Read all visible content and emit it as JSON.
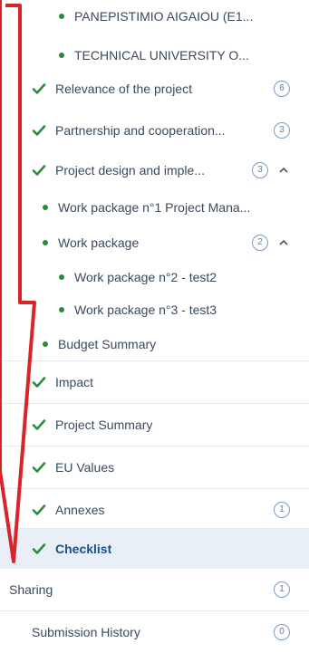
{
  "nav": {
    "items": [
      {
        "label": "PANEPISTIMIO AIGAIOU (E1...",
        "marker": "dot"
      },
      {
        "label": "TECHNICAL UNIVERSITY O...",
        "marker": "dot"
      },
      {
        "label": "Relevance of the project",
        "marker": "check",
        "count": "6"
      },
      {
        "label": "Partnership and cooperation...",
        "marker": "check",
        "count": "3"
      },
      {
        "label": "Project design and imple...",
        "marker": "check",
        "count": "3",
        "expanded": true
      },
      {
        "label": "Work package n°1 Project Mana...",
        "marker": "dot"
      },
      {
        "label": "Work package",
        "marker": "dot",
        "count": "2",
        "expanded": true
      },
      {
        "label": "Work package n°2 - test2",
        "marker": "dot"
      },
      {
        "label": "Work package n°3 - test3",
        "marker": "dot"
      },
      {
        "label": "Budget Summary",
        "marker": "dot"
      },
      {
        "label": "Impact",
        "marker": "check"
      },
      {
        "label": "Project Summary",
        "marker": "check"
      },
      {
        "label": "EU Values",
        "marker": "check"
      },
      {
        "label": "Annexes",
        "marker": "check",
        "count": "1"
      },
      {
        "label": "Checklist",
        "marker": "check",
        "active": true
      },
      {
        "label": "Sharing",
        "count": "1"
      },
      {
        "label": "Submission History",
        "count": "0"
      }
    ]
  },
  "colors": {
    "check": "#2e8b3b",
    "active_bg": "#e9eff6",
    "active_text": "#1f4d8f",
    "annotation_arrow": "#d9252a"
  },
  "icons": {
    "check": "check-icon",
    "dot": "bullet-dot-icon",
    "chevron": "chevron-up-icon",
    "badge": "count-badge"
  }
}
